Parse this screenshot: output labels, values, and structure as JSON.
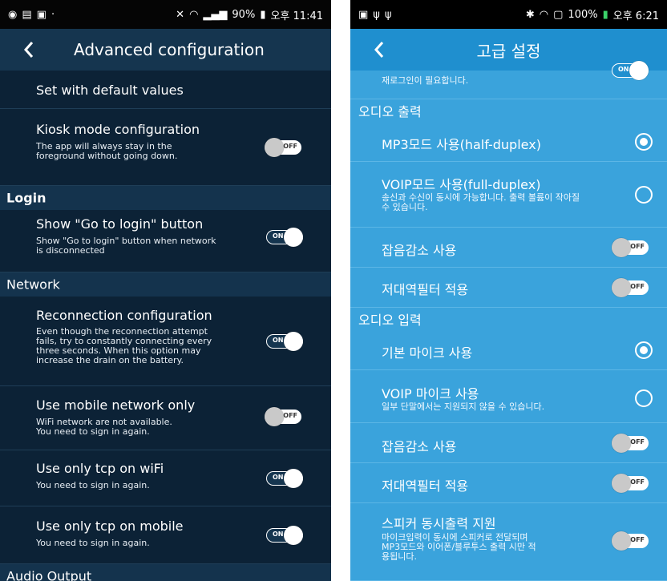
{
  "left": {
    "status": {
      "clock": "오후 11:41",
      "battery": "90%"
    },
    "appbar": {
      "title": "Advanced configuration"
    },
    "rows": {
      "default_values": {
        "label": "Set with default values"
      },
      "kiosk": {
        "label": "Kiosk mode configuration",
        "desc": "The app will always stay in the\nforeground without going down.",
        "toggle": "OFF"
      },
      "login_header": "Login",
      "go_to_login": {
        "label": "Show \"Go to login\" button",
        "desc": "Show \"Go to login\" button when network\nis disconnected",
        "toggle": "ON"
      },
      "network_header": "Network",
      "reconnection": {
        "label": "Reconnection configuration",
        "desc": "Even though the reconnection attempt\nfails, try to constantly connecting every\nthree seconds. When this option may\nincrease the drain on the battery.",
        "toggle": "ON"
      },
      "mobile_only": {
        "label": "Use mobile network only",
        "desc": "WiFi network are not available.\nYou need to sign in again.",
        "toggle": "OFF"
      },
      "tcp_wifi": {
        "label": "Use only tcp on wiFi",
        "desc": "You need to sign in again.",
        "toggle": "ON"
      },
      "tcp_mobile": {
        "label": "Use only tcp on mobile",
        "desc": "You need to sign in again.",
        "toggle": "ON"
      },
      "audio_output_header": "Audio Output"
    }
  },
  "right": {
    "status": {
      "clock": "오후 6:21",
      "battery": "100%"
    },
    "appbar": {
      "title": "고급 설정"
    },
    "rows": {
      "relogin": {
        "desc": "재로그인이 필요합니다.",
        "toggle": "ON"
      },
      "audio_output_header": "오디오 출력",
      "mp3_mode": {
        "label": "MP3모드 사용(half-duplex)"
      },
      "voip_mode": {
        "label": "VOIP모드 사용(full-duplex)",
        "desc": "송신과 수신이 동시에 가능합니다. 출력 볼륨이 작아질\n수 있습니다."
      },
      "noise_out": {
        "label": "잡음감소 사용",
        "toggle": "OFF"
      },
      "lowband_out": {
        "label": "저대역필터 적용",
        "toggle": "OFF"
      },
      "audio_input_header": "오디오 입력",
      "default_mic": {
        "label": "기본 마이크 사용"
      },
      "voip_mic": {
        "label": "VOIP 마이크 사용",
        "desc": "일부 단말에서는 지원되지 않을 수 있습니다."
      },
      "noise_in": {
        "label": "잡음감소 사용",
        "toggle": "OFF"
      },
      "lowband_in": {
        "label": "저대역필터 적용",
        "toggle": "OFF"
      },
      "speaker_sim": {
        "label": "스피커 동시출력 지원",
        "desc": "마이크입력이 동시에 스피커로 전달되며\nMP3모드와 이어폰/블루투스 출력 시만 적\n용됩니다.",
        "toggle": "OFF"
      }
    }
  },
  "colors": {
    "left_bg": "#0c2236",
    "left_appbar": "#15354f",
    "right_bg": "#3aa3dc",
    "right_appbar": "#1f8fcf"
  }
}
